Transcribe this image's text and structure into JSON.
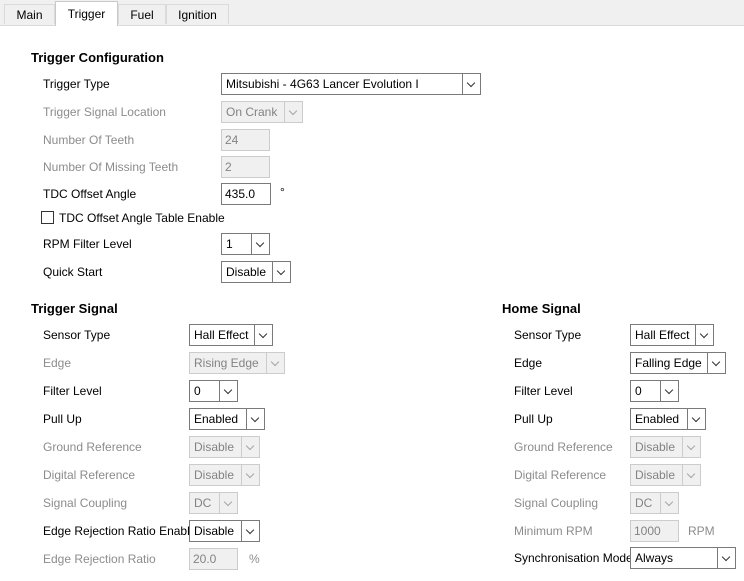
{
  "tabs": [
    {
      "label": "Main"
    },
    {
      "label": "Trigger"
    },
    {
      "label": "Fuel"
    },
    {
      "label": "Ignition"
    }
  ],
  "trigger_config": {
    "title": "Trigger Configuration",
    "trigger_type": {
      "label": "Trigger Type",
      "value": "Mitsubishi - 4G63 Lancer Evolution I"
    },
    "signal_location": {
      "label": "Trigger Signal Location",
      "value": "On Crank"
    },
    "num_teeth": {
      "label": "Number Of Teeth",
      "value": "24"
    },
    "num_missing": {
      "label": "Number Of Missing Teeth",
      "value": "2"
    },
    "tdc_offset": {
      "label": "TDC Offset Angle",
      "value": "435.0",
      "unit": "°"
    },
    "tdc_table": {
      "label": "TDC Offset Angle Table Enable",
      "checked": false
    },
    "rpm_filter": {
      "label": "RPM Filter Level",
      "value": "1"
    },
    "quick_start": {
      "label": "Quick Start",
      "value": "Disable"
    }
  },
  "trigger_signal": {
    "title": "Trigger Signal",
    "sensor_type": {
      "label": "Sensor Type",
      "value": "Hall Effect"
    },
    "edge": {
      "label": "Edge",
      "value": "Rising Edge"
    },
    "filter_level": {
      "label": "Filter Level",
      "value": "0"
    },
    "pull_up": {
      "label": "Pull Up",
      "value": "Enabled"
    },
    "ground_ref": {
      "label": "Ground Reference",
      "value": "Disable"
    },
    "digital_ref": {
      "label": "Digital Reference",
      "value": "Disable"
    },
    "coupling": {
      "label": "Signal Coupling",
      "value": "DC"
    },
    "edge_rej_enable": {
      "label": "Edge Rejection Ratio Enable",
      "value": "Disable"
    },
    "edge_rej_ratio": {
      "label": "Edge Rejection Ratio",
      "value": "20.0",
      "unit": "%"
    }
  },
  "home_signal": {
    "title": "Home Signal",
    "sensor_type": {
      "label": "Sensor Type",
      "value": "Hall Effect"
    },
    "edge": {
      "label": "Edge",
      "value": "Falling Edge"
    },
    "filter_level": {
      "label": "Filter Level",
      "value": "0"
    },
    "pull_up": {
      "label": "Pull Up",
      "value": "Enabled"
    },
    "ground_ref": {
      "label": "Ground Reference",
      "value": "Disable"
    },
    "digital_ref": {
      "label": "Digital Reference",
      "value": "Disable"
    },
    "coupling": {
      "label": "Signal Coupling",
      "value": "DC"
    },
    "min_rpm": {
      "label": "Minimum RPM",
      "value": "1000",
      "unit": "RPM"
    },
    "sync_mode": {
      "label": "Synchronisation Mode",
      "value": "Always"
    }
  }
}
